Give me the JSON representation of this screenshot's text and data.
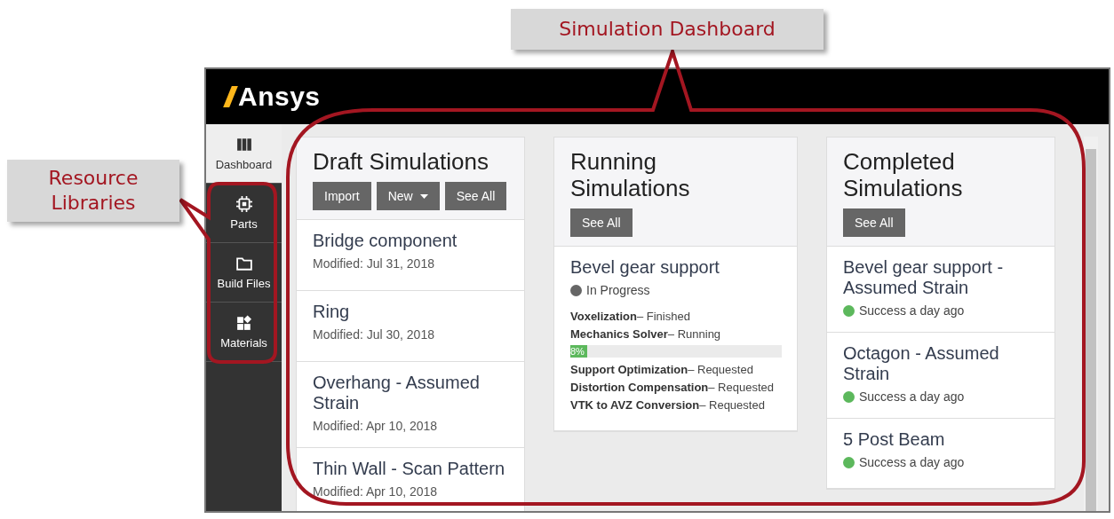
{
  "annotations": [
    {
      "label": "Simulation Dashboard"
    },
    {
      "label": "Resource Libraries"
    }
  ],
  "header": {
    "logo": "Ansys"
  },
  "sidebar": {
    "items": [
      {
        "label": "Dashboard",
        "selected": true
      },
      {
        "label": "Parts",
        "selected": false
      },
      {
        "label": "Build Files",
        "selected": false
      },
      {
        "label": "Materials",
        "selected": false
      }
    ]
  },
  "columns": [
    {
      "title": "Draft Simulations",
      "buttons": [
        {
          "label": "Import",
          "kind": "plain"
        },
        {
          "label": "New",
          "kind": "dropdown"
        },
        {
          "label": "See All",
          "kind": "plain"
        }
      ],
      "cards": [
        {
          "kind": "draft",
          "title": "Bridge component",
          "subtitle": "Modified: Jul 31, 2018"
        },
        {
          "kind": "draft",
          "title": "Ring",
          "subtitle": "Modified: Jul 30, 2018"
        },
        {
          "kind": "draft",
          "title": "Overhang - Assumed Strain",
          "subtitle": "Modified: Apr 10, 2018"
        },
        {
          "kind": "draft",
          "title": "Thin Wall - Scan Pattern",
          "subtitle": "Modified: Apr 10, 2018"
        }
      ]
    },
    {
      "title": "Running Simulations",
      "buttons": [
        {
          "label": "See All",
          "kind": "plain"
        }
      ],
      "cards": [
        {
          "kind": "running",
          "title": "Bevel gear support",
          "status": {
            "text": "In Progress",
            "color": "#666666"
          },
          "steps": [
            {
              "name": "Voxelization",
              "state": "– Finished"
            },
            {
              "name": "Mechanics Solver",
              "state": "– Running",
              "level": 0.08,
              "reading": "8%"
            },
            {
              "name": "Support Optimization",
              "state": "– Requested"
            },
            {
              "name": "Distortion Compensation",
              "state": "– Requested"
            },
            {
              "name": "VTK to AVZ Conversion",
              "state": "– Requested"
            }
          ]
        }
      ]
    },
    {
      "title": "Completed Simulations",
      "buttons": [
        {
          "label": "See All",
          "kind": "plain"
        }
      ],
      "cards": [
        {
          "kind": "completed",
          "title": "Bevel gear support - Assumed Strain",
          "status": {
            "text": "Success a day ago",
            "color": "#5cb85c"
          }
        },
        {
          "kind": "completed",
          "title": "Octagon - Assumed Strain",
          "status": {
            "text": "Success a day ago",
            "color": "#5cb85c"
          }
        },
        {
          "kind": "completed",
          "title": "5 Post Beam",
          "status": {
            "text": "Success a day ago",
            "color": "#5cb85c"
          }
        }
      ]
    }
  ]
}
